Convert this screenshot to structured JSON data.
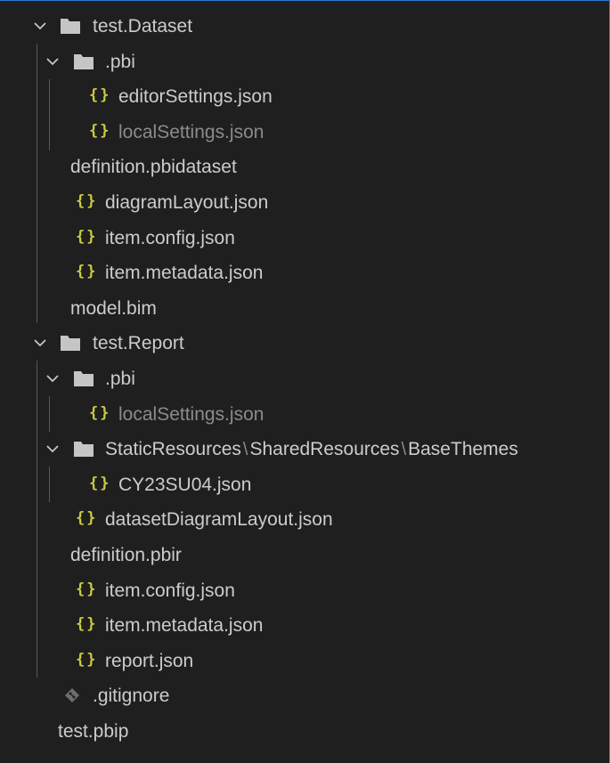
{
  "colors": {
    "background": "#1f1f1f",
    "text": "#cccccc",
    "dim_text": "#8b8b8b",
    "json_icon": "#cbcb41",
    "folder_icon": "#c5c5c5",
    "guide": "#585858",
    "accent_border": "#2b79d6"
  },
  "icons": {
    "json": "{}",
    "path_separator": "\\"
  },
  "tree": {
    "dataset_folder": "test.Dataset",
    "dataset_pbi_folder": ".pbi",
    "dataset_editor_settings": "editorSettings.json",
    "dataset_local_settings": "localSettings.json",
    "dataset_definition": "definition.pbidataset",
    "dataset_diagram_layout": "diagramLayout.json",
    "dataset_item_config": "item.config.json",
    "dataset_item_metadata": "item.metadata.json",
    "dataset_model": "model.bim",
    "report_folder": "test.Report",
    "report_pbi_folder": ".pbi",
    "report_local_settings": "localSettings.json",
    "report_static_resources": "StaticResources",
    "report_shared_resources": "SharedResources",
    "report_base_themes": "BaseThemes",
    "report_theme_file": "CY23SU04.json",
    "report_dataset_diagram_layout": "datasetDiagramLayout.json",
    "report_definition": "definition.pbir",
    "report_item_config": "item.config.json",
    "report_item_metadata": "item.metadata.json",
    "report_json": "report.json",
    "gitignore": ".gitignore",
    "pbip": "test.pbip"
  }
}
